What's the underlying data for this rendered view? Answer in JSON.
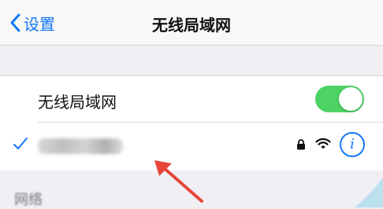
{
  "navbar": {
    "back_label": "设置",
    "title": "无线局域网"
  },
  "wifi_toggle": {
    "label": "无线局域网",
    "state": "on",
    "color": "#4dd264"
  },
  "network": {
    "selected": true,
    "name_visibility": "blurred",
    "icons": [
      "checkmark-icon",
      "lock-icon",
      "wifi-signal-icon",
      "info-icon"
    ],
    "info_glyph": "i"
  },
  "below_section": {
    "partial_label": "网络"
  },
  "annotation": {
    "arrow_color": "#e8453c"
  },
  "colors": {
    "accent": "#1477f8",
    "background": "#efeff4"
  }
}
